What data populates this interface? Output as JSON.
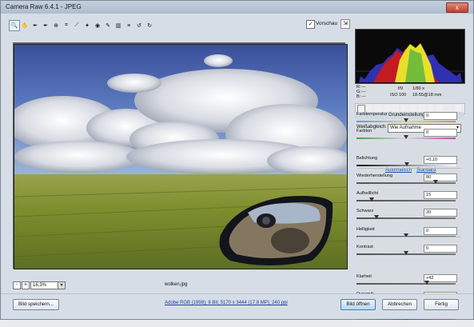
{
  "window": {
    "title": "Camera Raw 6.4.1 - JPEG",
    "close_label": "x"
  },
  "toolbar": {
    "tools": [
      {
        "name": "zoom-tool-icon",
        "glyph": "🔍"
      },
      {
        "name": "hand-tool-icon",
        "glyph": "✋"
      },
      {
        "name": "white-balance-tool-icon",
        "glyph": "✒"
      },
      {
        "name": "color-sampler-tool-icon",
        "glyph": "✒"
      },
      {
        "name": "targeted-adjustment-tool-icon",
        "glyph": "⊕"
      },
      {
        "name": "crop-tool-icon",
        "glyph": "⌗"
      },
      {
        "name": "straighten-tool-icon",
        "glyph": "⟋"
      },
      {
        "name": "spot-removal-tool-icon",
        "glyph": "✦"
      },
      {
        "name": "red-eye-tool-icon",
        "glyph": "◉"
      },
      {
        "name": "adjustment-brush-icon",
        "glyph": "✎"
      },
      {
        "name": "graduated-filter-icon",
        "glyph": "▥"
      },
      {
        "name": "preferences-icon",
        "glyph": "≡"
      },
      {
        "name": "rotate-left-icon",
        "glyph": "↺"
      },
      {
        "name": "rotate-right-icon",
        "glyph": "↻"
      }
    ],
    "preview_label": "Vorschau",
    "preview_checked": "✓",
    "fullscreen_glyph": "⇲"
  },
  "status": {
    "zoom_value": "16,3%",
    "zoom_minus": "-",
    "zoom_plus": "+",
    "zoom_drop": "▾",
    "filename": "wolken.jpg"
  },
  "readout": {
    "r": "R:",
    "r_val": "---",
    "g": "G:",
    "g_val": "---",
    "b": "B:",
    "b_val": "---",
    "aperture": "f/9",
    "shutter": "1/80 s",
    "iso": "ISO 100",
    "lens": "18-55@18 mm"
  },
  "panel": {
    "section_title": "Grundeinstellungen",
    "wb_label": "Weißabgleich:",
    "wb_value": "Wie Aufnahme",
    "auto_link": "Automatisch",
    "default_link": "Standard",
    "sliders": [
      {
        "label": "Farbtemperatur",
        "value": "0",
        "level": 0.5
      },
      {
        "label": "Farbton",
        "value": "0",
        "level": 0.5
      },
      {
        "label": "Belichtung",
        "value": "+0,10",
        "level": 0.51
      },
      {
        "label": "Wiederherstellung",
        "value": "80",
        "level": 0.8
      },
      {
        "label": "Aufhelllicht",
        "value": "15",
        "level": 0.15
      },
      {
        "label": "Schwarz",
        "value": "20",
        "level": 0.2
      },
      {
        "label": "Helligkeit",
        "value": "0",
        "level": 0.5
      },
      {
        "label": "Kontrast",
        "value": "0",
        "level": 0.5
      },
      {
        "label": "Klarheit",
        "value": "+42",
        "level": 0.71
      },
      {
        "label": "Dynamik",
        "value": "0",
        "level": 0.5
      },
      {
        "label": "Sättigung",
        "value": "0",
        "level": 0.5
      }
    ]
  },
  "bottom": {
    "save_label": "Bild speichern...",
    "info_link": "Adobe RGB (1998); 8 Bit; 5170 x 3444 (17,8 MP); 240 ppi",
    "open_label": "Bild öffnen",
    "cancel_label": "Abbrechen",
    "done_label": "Fertig"
  }
}
